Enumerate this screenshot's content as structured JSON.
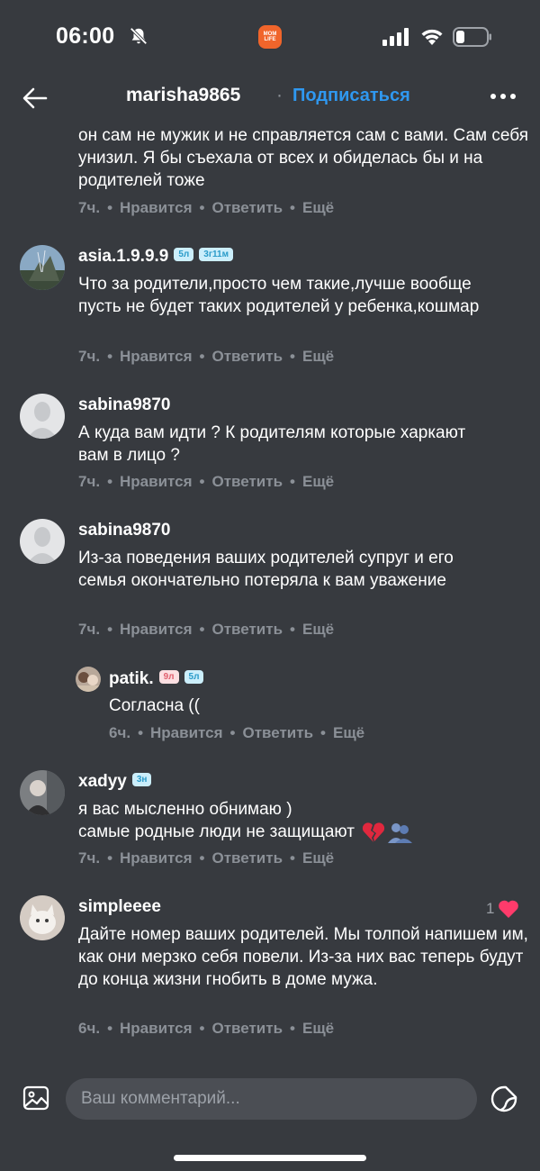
{
  "status_bar": {
    "time": "06:00",
    "app_badge": "MOM LIFE"
  },
  "header": {
    "username": "marisha9865",
    "dot": "·",
    "subscribe_label": "Подписаться"
  },
  "meta_labels": {
    "like": "Нравится",
    "reply": "Ответить",
    "more": "Ещё",
    "sep": "•"
  },
  "comments": [
    {
      "text": "он сам не мужик и не справляется сам с вами. Сам себя унизил. Я бы съехала от всех и обиделась бы и на родителей тоже",
      "time": "7ч."
    },
    {
      "username": "asia.1.9.9.9",
      "badges": [
        "5л",
        "3г11м"
      ],
      "text": "Что за родители,просто чем такие,лучше вообще пусть не будет таких родителей у ребенка,кошмар",
      "time": "7ч."
    },
    {
      "username": "sabina9870",
      "text": "А куда вам идти ? К родителям которые харкают вам в лицо ?",
      "time": "7ч."
    },
    {
      "username": "sabina9870",
      "text": "Из-за поведения ваших родителей супруг и его семья окончательно потеряла к вам уважение",
      "time": "7ч."
    },
    {
      "username": "patik.",
      "badges": [
        "9л",
        "5л"
      ],
      "text": "Согласна ((",
      "time": "6ч."
    },
    {
      "username": "xadyy",
      "badges": [
        "3н"
      ],
      "text_line1": "я вас мысленно обнимаю )",
      "text_line2": "самые родные люди не защищают",
      "time": "7ч."
    },
    {
      "username": "simpleeee",
      "like_count": "1",
      "text": "Дайте номер ваших родителей. Мы толпой напишем им, как они мерзко  себя повели. Из-за них вас теперь будут до конца жизни гнобить в доме мужа.",
      "time": "6ч."
    }
  ],
  "composer": {
    "placeholder": "Ваш комментарий..."
  },
  "colors": {
    "background": "#373a3f",
    "accent": "#2f98f0",
    "meta": "#8b9097",
    "heart": "#ff3b6b"
  }
}
